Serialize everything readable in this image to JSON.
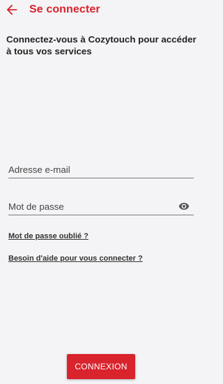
{
  "header": {
    "title": "Se connecter",
    "back_icon": "arrow-left-icon",
    "accent_color": "#d9232d"
  },
  "intro_text": "Connectez-vous à Cozytouch pour accéder à tous vos services",
  "form": {
    "email": {
      "placeholder": "Adresse e-mail",
      "value": ""
    },
    "password": {
      "placeholder": "Mot de passe",
      "value": "",
      "toggle_icon": "eye-icon"
    }
  },
  "links": {
    "forgot_password": "Mot de passe oublié ?",
    "need_help": "Besoin d'aide pour vous connecter ?"
  },
  "submit_label": "CONNEXION"
}
